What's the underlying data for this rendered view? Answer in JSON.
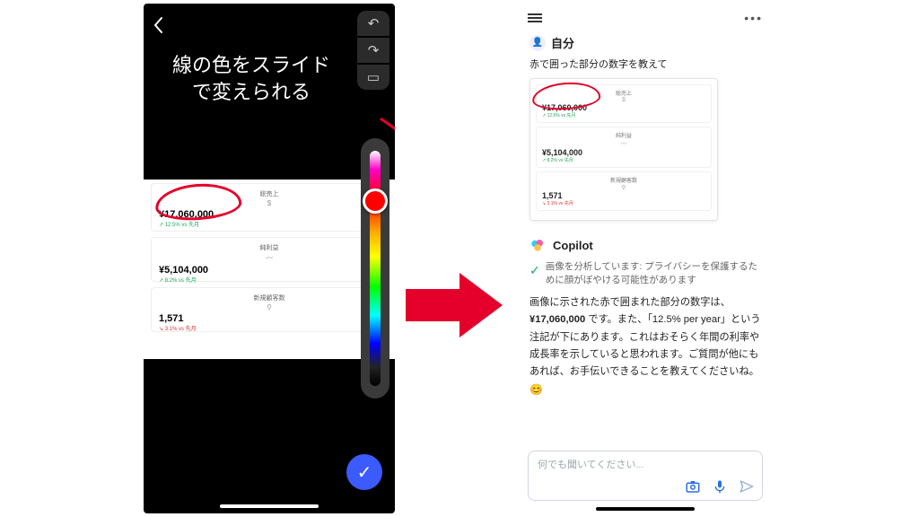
{
  "left": {
    "headline_l1": "線の色をスライド",
    "headline_l2": "で変えられる",
    "back_icon": "chevron-left",
    "tools": {
      "undo": "↶",
      "redo": "↷",
      "crop": "▭"
    },
    "cards": [
      {
        "label": "総売上",
        "icon": "$",
        "value": "¥17,060,000",
        "sub": "↗ 12.5% vs 先月",
        "sub_color": "green"
      },
      {
        "label": "純利益",
        "icon": "〰",
        "value": "¥5,104,000",
        "sub": "↗ 8.2% vs 先月",
        "sub_color": "green"
      },
      {
        "label": "新規顧客数",
        "icon": "⚲",
        "value": "1,571",
        "sub": "↘ 3.1% vs 先月",
        "sub_color": "red"
      }
    ],
    "slider": {
      "thumb_color": "#ff0000"
    },
    "confirm": "✓"
  },
  "right": {
    "user_name": "自分",
    "user_message": "赤で囲った部分の数字を教えて",
    "attachment_cards": [
      {
        "label": "総売上",
        "icon": "$",
        "value": "¥17,060,000",
        "sub": "↗ 12.5% vs 先月",
        "sub_color": "green"
      },
      {
        "label": "純利益",
        "icon": "〰",
        "value": "¥5,104,000",
        "sub": "↗ 8.2% vs 先月",
        "sub_color": "green"
      },
      {
        "label": "新規顧客数",
        "icon": "⚲",
        "value": "1,571",
        "sub": "↘ 3.1% vs 先月",
        "sub_color": "red"
      }
    ],
    "assistant_name": "Copilot",
    "analysis_note": "画像を分析しています: プライバシーを保護するために顔がぼやける可能性があります",
    "answer_1": "画像に示された赤で囲まれた部分の数字は、",
    "answer_value": "¥17,060,000",
    "answer_2": "です。また、「12.5% per year」という注記が下にあります。これはおそらく年間の利率や成長率を示していると思われます。ご質問が他にもあれば、お手伝いできることを教えてくださいね。",
    "emoji": "😊",
    "input_placeholder": "何でも聞いてください...",
    "icons": {
      "camera": "camera-icon",
      "mic": "mic-icon",
      "send": "send-icon"
    }
  },
  "colors": {
    "accent_red": "#e4002b",
    "confirm_blue": "#3b5bff",
    "ok_green": "#1ea85f"
  }
}
